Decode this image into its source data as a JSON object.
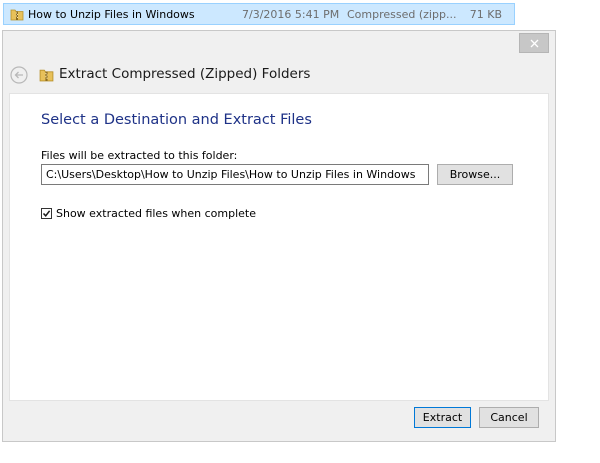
{
  "file_row": {
    "name": "How to Unzip Files in Windows",
    "date_modified": "7/3/2016 5:41 PM",
    "type": "Compressed (zipp...",
    "size": "71 KB",
    "icon": "zip-folder-icon"
  },
  "dialog": {
    "title": "Extract Compressed (Zipped) Folders",
    "close_icon": "close-icon",
    "back_icon": "back-arrow-icon",
    "section_title": "Select a Destination and Extract Files",
    "path_label": "Files will be extracted to this folder:",
    "path_value": "C:\\Users\\Desktop\\How to Unzip Files\\How to Unzip Files in Windows",
    "browse_label": "Browse...",
    "show_files_label": "Show extracted files when complete",
    "show_files_checked": true,
    "extract_label": "Extract",
    "cancel_label": "Cancel"
  },
  "colors": {
    "selection_background": "#cce8ff",
    "section_title": "#1e3287",
    "default_button_border": "#0078d7"
  }
}
